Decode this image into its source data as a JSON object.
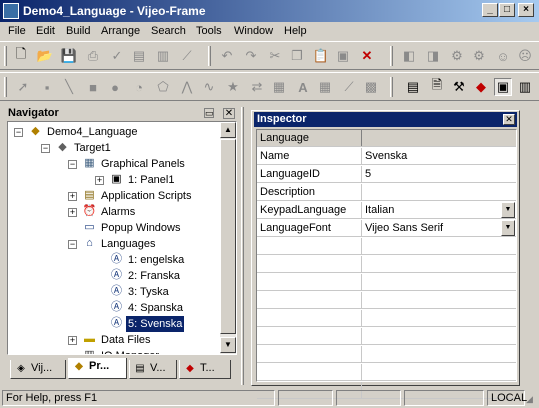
{
  "window": {
    "title": "Demo4_Language - Vijeo-Frame",
    "minimize": "_",
    "maximize": "□",
    "close": "×"
  },
  "menu": [
    "File",
    "Edit",
    "Build",
    "Arrange",
    "Search",
    "Tools",
    "Window",
    "Help"
  ],
  "navigator": {
    "title": "Navigator",
    "tree": [
      {
        "label": "Demo4_Language",
        "icon": "project-icon",
        "level": 0,
        "expander": "-"
      },
      {
        "label": "Target1",
        "icon": "target-icon",
        "level": 1,
        "expander": "-"
      },
      {
        "label": "Graphical Panels",
        "icon": "panels-folder-icon",
        "level": 2,
        "expander": "-"
      },
      {
        "label": "1: Panel1",
        "icon": "panel-icon",
        "level": 3,
        "expander": "+"
      },
      {
        "label": "Application Scripts",
        "icon": "scripts-icon",
        "level": 2,
        "expander": "+"
      },
      {
        "label": "Alarms",
        "icon": "alarm-icon",
        "level": 2,
        "expander": "+"
      },
      {
        "label": "Popup Windows",
        "icon": "window-icon",
        "level": 2,
        "expander": ""
      },
      {
        "label": "Languages",
        "icon": "languages-icon",
        "level": 2,
        "expander": "-"
      },
      {
        "label": "1: engelska",
        "icon": "language-icon",
        "level": 3,
        "expander": ""
      },
      {
        "label": "2: Franska",
        "icon": "language-icon",
        "level": 3,
        "expander": ""
      },
      {
        "label": "3: Tyska",
        "icon": "language-icon",
        "level": 3,
        "expander": ""
      },
      {
        "label": "4: Spanska",
        "icon": "language-icon",
        "level": 3,
        "expander": ""
      },
      {
        "label": "5: Svenska",
        "icon": "language-icon",
        "level": 3,
        "expander": "",
        "selected": true
      },
      {
        "label": "Data Files",
        "icon": "data-files-icon",
        "level": 2,
        "expander": "+"
      },
      {
        "label": "IO Manager",
        "icon": "io-manager-icon",
        "level": 2,
        "expander": ""
      }
    ],
    "tabs": [
      {
        "label": "Vij...",
        "icon": "vijeo-icon",
        "active": false
      },
      {
        "label": "Pr...",
        "icon": "project-icon",
        "active": true
      },
      {
        "label": "V...",
        "icon": "variables-icon",
        "active": false
      },
      {
        "label": "T...",
        "icon": "toolbox-icon",
        "active": false
      }
    ]
  },
  "inspector": {
    "title": "Inspector",
    "header": "Language",
    "rows": [
      {
        "name": "Name",
        "value": "Svenska",
        "dropdown": false
      },
      {
        "name": "LanguageID",
        "value": "5",
        "dropdown": false
      },
      {
        "name": "Description",
        "value": "",
        "dropdown": false
      },
      {
        "name": "KeypadLanguage",
        "value": "Italian",
        "dropdown": true
      },
      {
        "name": "LanguageFont",
        "value": "Vijeo Sans Serif",
        "dropdown": true
      }
    ]
  },
  "status": {
    "help_text": "For Help, press F1",
    "mode": "LOCAL"
  },
  "colors": {
    "title_bar": "#0a246a",
    "selection": "#0a246a",
    "face": "#d4d0c8"
  }
}
